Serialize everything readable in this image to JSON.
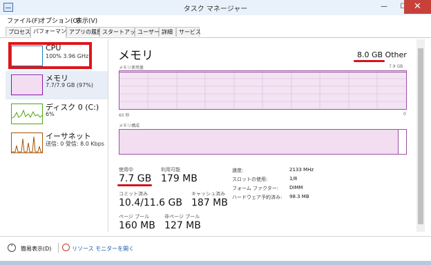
{
  "window": {
    "title": "タスク マネージャー",
    "minimize": "—",
    "maximize": "☐",
    "close": "✕"
  },
  "menu": [
    "ファイル(F)",
    "オプション(O)",
    "表示(V)"
  ],
  "tabs": [
    {
      "label": "プロセス",
      "active": false
    },
    {
      "label": "パフォーマンス",
      "active": true
    },
    {
      "label": "アプリの履歴",
      "active": false
    },
    {
      "label": "スタートアップ",
      "active": false
    },
    {
      "label": "ユーザー",
      "active": false
    },
    {
      "label": "詳細",
      "active": false
    },
    {
      "label": "サービス",
      "active": false
    }
  ],
  "resources": [
    {
      "name": "CPU",
      "detail": "100% 3.96 GHz",
      "color": "#117dbb"
    },
    {
      "name": "メモリ",
      "detail": "7.7/7.9 GB (97%)",
      "color": "#8b12ae"
    },
    {
      "name": "ディスク 0 (C:)",
      "detail": "6%",
      "color": "#4da60c"
    },
    {
      "name": "イーサネット",
      "detail": "送信: 0 受信: 8.0 Kbps",
      "color": "#a74f01"
    }
  ],
  "memory": {
    "title": "メモリ",
    "total": "8.0 GB Other",
    "usage_label": "メモリ使用量",
    "usage_max": "7.9 GB",
    "time_left": "60 秒",
    "time_right": "0",
    "composition_label": "メモリ構成",
    "composition_in_use_fraction": 0.97,
    "stats": {
      "in_use_label": "使用中",
      "in_use": "7.7 GB",
      "available_label": "利用可能",
      "available": "179 MB",
      "committed_label": "コミット済み",
      "committed": "10.4/11.6 GB",
      "cached_label": "キャッシュ済み",
      "cached": "187 MB",
      "paged_pool_label": "ページ プール",
      "paged_pool": "160 MB",
      "nonpaged_pool_label": "非ページ プール",
      "nonpaged_pool": "127 MB"
    },
    "specs": [
      {
        "label": "速度:",
        "value": "2133 MHz"
      },
      {
        "label": "スロットの使用:",
        "value": "1/8"
      },
      {
        "label": "フォーム ファクター:",
        "value": "DIMM"
      },
      {
        "label": "ハードウェア予約済み:",
        "value": "98.3 MB"
      }
    ]
  },
  "footer": {
    "fewer_details": "簡易表示(D)",
    "resource_monitor": "リソース モニターを開く"
  },
  "colors": {
    "highlight": "#e0141b",
    "memory_accent": "#9a4fa3"
  }
}
